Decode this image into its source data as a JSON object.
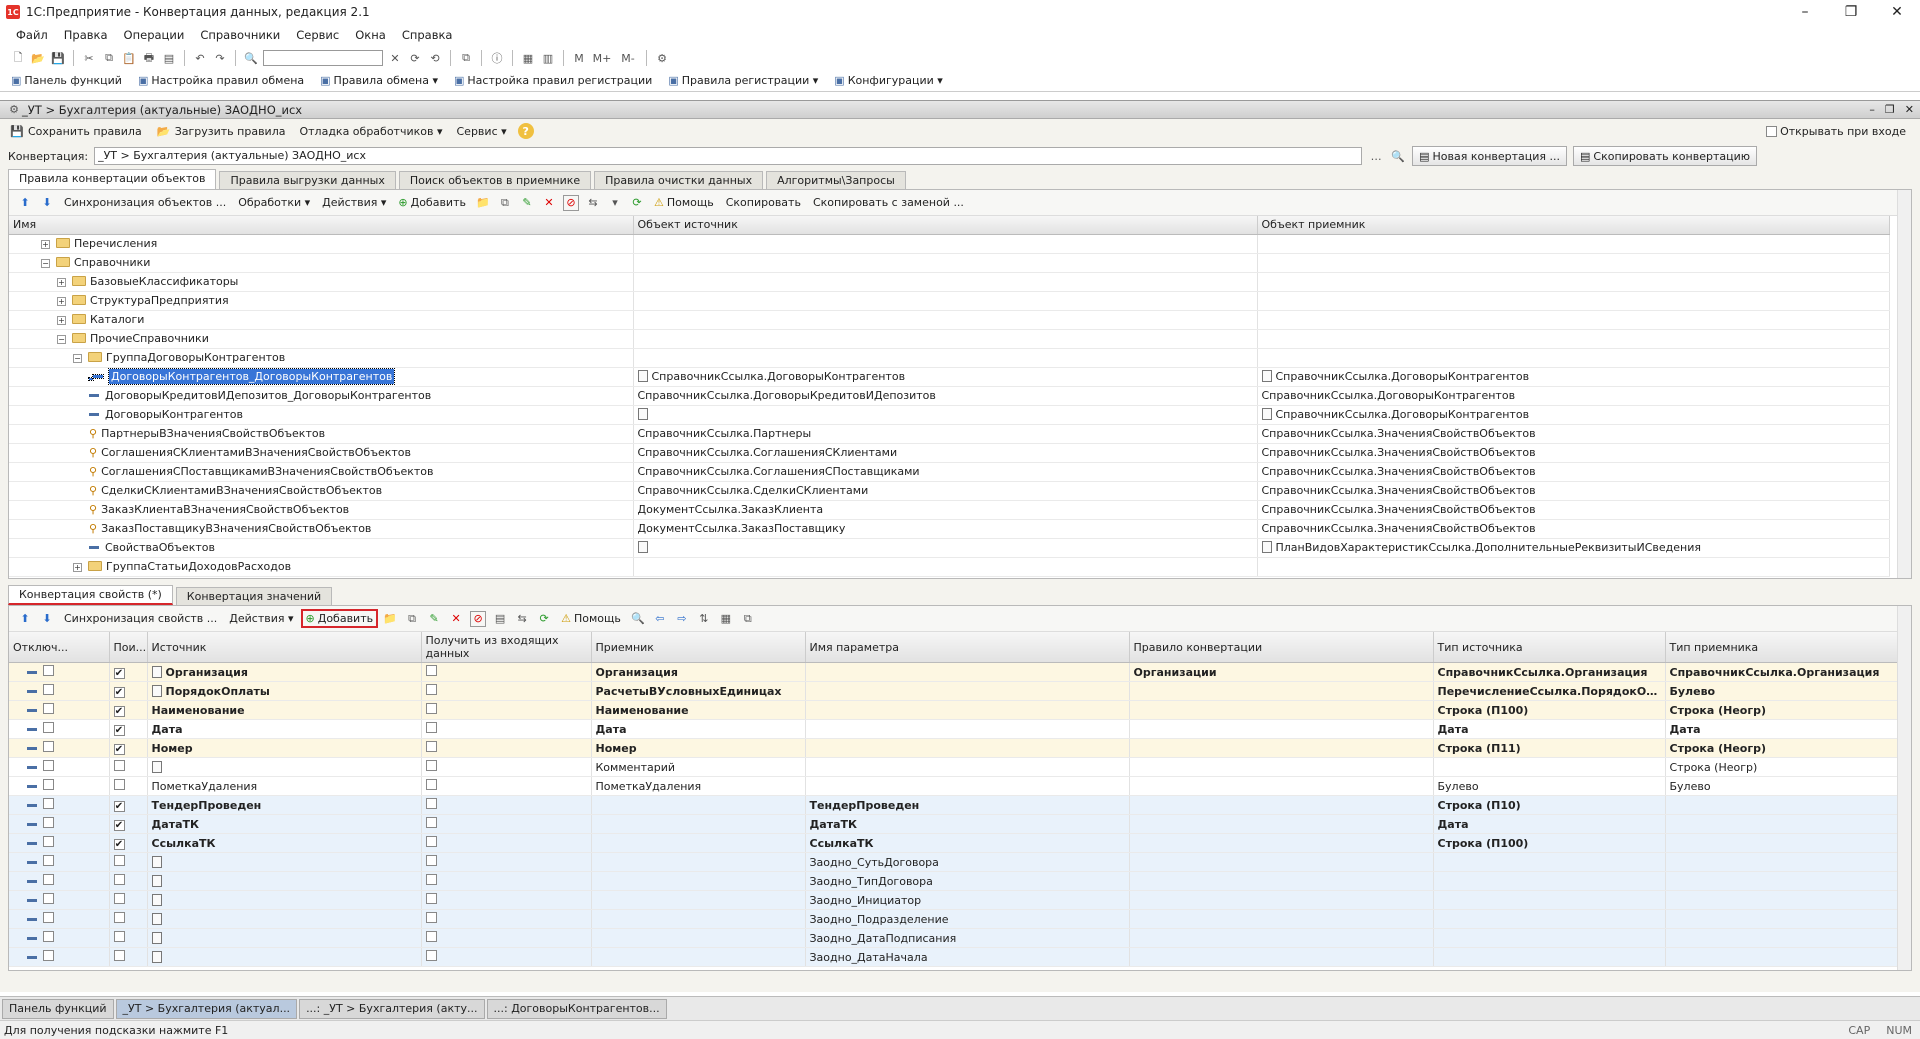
{
  "window": {
    "title": "1С:Предприятие - Конвертация данных, редакция 2.1",
    "logo": "1С"
  },
  "menu": [
    "Файл",
    "Правка",
    "Операции",
    "Справочники",
    "Сервис",
    "Окна",
    "Справка"
  ],
  "funcbar": [
    "Панель функций",
    "Настройка правил обмена",
    "Правила обмена ▾",
    "Настройка правил регистрации",
    "Правила регистрации ▾",
    "Конфигурации ▾"
  ],
  "doc": {
    "title": "_УТ > Бухгалтерия (актуальные) ЗАОДНО_исх",
    "commands": [
      "Сохранить правила",
      "Загрузить правила",
      "Отладка обработчиков ▾",
      "Сервис ▾"
    ],
    "open_on_start": "Открывать при входе",
    "conv_label": "Конвертация:",
    "conv_value": "_УТ > Бухгалтерия (актуальные) ЗАОДНО_исх",
    "new_conv": "Новая конвертация ...",
    "copy_conv": "Скопировать конвертацию"
  },
  "top_tabs": [
    "Правила конвертации объектов",
    "Правила выгрузки данных",
    "Поиск объектов в приемнике",
    "Правила очистки данных",
    "Алгоритмы\\Запросы"
  ],
  "top_toolbar": [
    "Синхронизация объектов ...",
    "Обработки ▾",
    "Действия ▾",
    "Добавить",
    "Помощь",
    "Скопировать",
    "Скопировать с заменой ..."
  ],
  "top_headers": [
    "Имя",
    "Объект источник",
    "Объект приемник"
  ],
  "top_rows": [
    {
      "ind": 2,
      "ico": "folder",
      "exp": "+",
      "name": "Перечисления",
      "src": "",
      "dst": ""
    },
    {
      "ind": 2,
      "ico": "folder",
      "exp": "−",
      "name": "Справочники",
      "src": "",
      "dst": ""
    },
    {
      "ind": 3,
      "ico": "folder",
      "exp": "+",
      "name": "БазовыеКлассификаторы",
      "src": "",
      "dst": ""
    },
    {
      "ind": 3,
      "ico": "folder",
      "exp": "+",
      "name": "СтруктураПредприятия",
      "src": "",
      "dst": ""
    },
    {
      "ind": 3,
      "ico": "folder",
      "exp": "+",
      "name": "Каталоги",
      "src": "",
      "dst": ""
    },
    {
      "ind": 3,
      "ico": "folder",
      "exp": "−",
      "name": "ПрочиеСправочники",
      "src": "",
      "dst": ""
    },
    {
      "ind": 4,
      "ico": "folder",
      "exp": "−",
      "name": "ГруппаДоговорыКонтрагентов",
      "src": "",
      "dst": ""
    },
    {
      "ind": 5,
      "ico": "dash",
      "name": "ДоговорыКонтрагентов_ДоговорыКонтрагентов",
      "src": "СправочникСсылка.ДоговорыКонтрагентов",
      "dst": "СправочникСсылка.ДоговорыКонтрагентов",
      "sel": true,
      "srcico": true,
      "dstico": true
    },
    {
      "ind": 5,
      "ico": "dash",
      "name": "ДоговорыКредитовИДепозитов_ДоговорыКонтрагентов",
      "src": "СправочникСсылка.ДоговорыКредитовИДепозитов",
      "dst": "СправочникСсылка.ДоговорыКонтрагентов"
    },
    {
      "ind": 5,
      "ico": "dash",
      "name": "ДоговорыКонтрагентов",
      "src": "",
      "dst": "СправочникСсылка.ДоговорыКонтрагентов",
      "srcico": true,
      "dstico": true
    },
    {
      "ind": 5,
      "ico": "key",
      "name": "ПартнерыВЗначенияСвойствОбъектов",
      "src": "СправочникСсылка.Партнеры",
      "dst": "СправочникСсылка.ЗначенияСвойствОбъектов"
    },
    {
      "ind": 5,
      "ico": "key",
      "name": "СоглашенияСКлиентамиВЗначенияСвойствОбъектов",
      "src": "СправочникСсылка.СоглашенияСКлиентами",
      "dst": "СправочникСсылка.ЗначенияСвойствОбъектов"
    },
    {
      "ind": 5,
      "ico": "key",
      "name": "СоглашенияСПоставщикамиВЗначенияСвойствОбъектов",
      "src": "СправочникСсылка.СоглашенияСПоставщиками",
      "dst": "СправочникСсылка.ЗначенияСвойствОбъектов"
    },
    {
      "ind": 5,
      "ico": "key",
      "name": "СделкиСКлиентамиВЗначенияСвойствОбъектов",
      "src": "СправочникСсылка.СделкиСКлиентами",
      "dst": "СправочникСсылка.ЗначенияСвойствОбъектов"
    },
    {
      "ind": 5,
      "ico": "key",
      "name": "ЗаказКлиентаВЗначенияСвойствОбъектов",
      "src": "ДокументСсылка.ЗаказКлиента",
      "dst": "СправочникСсылка.ЗначенияСвойствОбъектов"
    },
    {
      "ind": 5,
      "ico": "key",
      "name": "ЗаказПоставщикуВЗначенияСвойствОбъектов",
      "src": "ДокументСсылка.ЗаказПоставщику",
      "dst": "СправочникСсылка.ЗначенияСвойствОбъектов"
    },
    {
      "ind": 5,
      "ico": "dash",
      "name": "СвойстваОбъектов",
      "src": "",
      "dst": "ПланВидовХарактеристикСсылка.ДополнительныеРеквизитыИСведения",
      "srcico": true,
      "dstico": true
    },
    {
      "ind": 4,
      "ico": "folder",
      "exp": "+",
      "name": "ГруппаСтатьиДоходовРасходов",
      "src": "",
      "dst": ""
    }
  ],
  "bottom_tabs": [
    "Конвертация свойств (*)",
    "Конвертация значений"
  ],
  "bottom_toolbar": [
    "Синхронизация свойств ...",
    "Действия ▾",
    "Добавить",
    "Помощь"
  ],
  "bottom_headers": [
    "Отключ...",
    "Пои...",
    "Источник",
    "Получить из входящих данных",
    "Приемник",
    "Имя параметра",
    "Правило конвертации",
    "Тип источника",
    "Тип приемника"
  ],
  "bottom_rows": [
    {
      "c": "yellow",
      "b": true,
      "off": false,
      "srch": true,
      "srcico": true,
      "src": "Организация",
      "get": false,
      "dst": "Организация",
      "param": "",
      "rule": "Организации",
      "tsrc": "СправочникСсылка.Организация",
      "tdst": "СправочникСсылка.Организация"
    },
    {
      "c": "yellow",
      "b": true,
      "off": false,
      "srch": true,
      "srcico": true,
      "src": "ПорядокОплаты",
      "get": false,
      "dst": "РасчетыВУсловныхЕдиницах",
      "param": "",
      "rule": "",
      "tsrc": "ПеречислениеСсылка.ПорядокОплаты",
      "tdst": "Булево"
    },
    {
      "c": "yellow",
      "b": true,
      "off": false,
      "srch": true,
      "src": "Наименование",
      "get": false,
      "dst": "Наименование",
      "param": "",
      "rule": "",
      "tsrc": "Строка (П100)",
      "tdst": "Строка (Неогр)"
    },
    {
      "c": "",
      "b": true,
      "off": false,
      "srch": true,
      "src": "Дата",
      "get": false,
      "dst": "Дата",
      "param": "",
      "rule": "",
      "tsrc": "Дата",
      "tdst": "Дата"
    },
    {
      "c": "yellow",
      "b": true,
      "off": false,
      "srch": true,
      "src": "Номер",
      "get": false,
      "dst": "Номер",
      "param": "",
      "rule": "",
      "tsrc": "Строка (П11)",
      "tdst": "Строка (Неогр)"
    },
    {
      "c": "",
      "b": false,
      "off": false,
      "srch": false,
      "srcico": true,
      "src": "",
      "get": false,
      "dst": "Комментарий",
      "param": "",
      "rule": "",
      "tsrc": "",
      "tdst": "Строка (Неогр)"
    },
    {
      "c": "",
      "b": false,
      "off": false,
      "srch": false,
      "src": "ПометкаУдаления",
      "get": false,
      "dst": "ПометкаУдаления",
      "param": "",
      "rule": "",
      "tsrc": "Булево",
      "tdst": "Булево"
    },
    {
      "c": "blue",
      "b": true,
      "off": false,
      "srch": true,
      "src": "ТендерПроведен",
      "get": false,
      "dst": "",
      "param": "ТендерПроведен",
      "rule": "",
      "tsrc": "Строка (П10)",
      "tdst": ""
    },
    {
      "c": "blue",
      "b": true,
      "off": false,
      "srch": true,
      "src": "ДатаТК",
      "get": false,
      "dst": "",
      "param": "ДатаТК",
      "rule": "",
      "tsrc": "Дата",
      "tdst": ""
    },
    {
      "c": "blue",
      "b": true,
      "off": false,
      "srch": true,
      "src": "СсылкаТК",
      "get": false,
      "dst": "",
      "param": "СсылкаТК",
      "rule": "",
      "tsrc": "Строка (П100)",
      "tdst": ""
    },
    {
      "c": "blue",
      "b": false,
      "off": false,
      "srch": false,
      "srcico": true,
      "src": "",
      "get": false,
      "dst": "",
      "param": "Заодно_СутьДоговора",
      "rule": "",
      "tsrc": "",
      "tdst": ""
    },
    {
      "c": "blue",
      "b": false,
      "off": false,
      "srch": false,
      "srcico": true,
      "src": "",
      "get": false,
      "dst": "",
      "param": "Заодно_ТипДоговора",
      "rule": "",
      "tsrc": "",
      "tdst": ""
    },
    {
      "c": "blue",
      "b": false,
      "off": false,
      "srch": false,
      "srcico": true,
      "src": "",
      "get": false,
      "dst": "",
      "param": "Заодно_Инициатор",
      "rule": "",
      "tsrc": "",
      "tdst": ""
    },
    {
      "c": "blue",
      "b": false,
      "off": false,
      "srch": false,
      "srcico": true,
      "src": "",
      "get": false,
      "dst": "",
      "param": "Заодно_Подразделение",
      "rule": "",
      "tsrc": "",
      "tdst": ""
    },
    {
      "c": "blue",
      "b": false,
      "off": false,
      "srch": false,
      "srcico": true,
      "src": "",
      "get": false,
      "dst": "",
      "param": "Заодно_ДатаПодписания",
      "rule": "",
      "tsrc": "",
      "tdst": ""
    },
    {
      "c": "blue",
      "b": false,
      "off": false,
      "srch": false,
      "srcico": true,
      "src": "",
      "get": false,
      "dst": "",
      "param": "Заодно_ДатаНачала",
      "rule": "",
      "tsrc": "",
      "tdst": ""
    }
  ],
  "taskbar": [
    "Панель функций",
    "_УТ > Бухгалтерия (актуал...",
    "...: _УТ > Бухгалтерия (акту...",
    "...: ДоговорыКонтрагентов..."
  ],
  "status": {
    "hint": "Для получения подсказки нажмите F1",
    "cap": "CAP",
    "num": "NUM"
  }
}
